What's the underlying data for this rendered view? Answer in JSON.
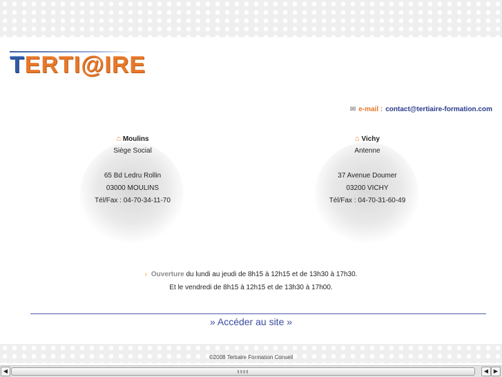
{
  "logo": {
    "first": "T",
    "rest": "ERTI@IRE"
  },
  "email": {
    "icon": "envelope-icon",
    "label": "e-mail :",
    "address": "contact@tertiaire-formation.com"
  },
  "offices": [
    {
      "icon": "home-icon",
      "city": "Moulins",
      "role": "Siège Social",
      "street": "65 Bd Ledru Rollin",
      "postal": "03000 MOULINS",
      "phone": "Tél/Fax : 04-70-34-11-70"
    },
    {
      "icon": "home-icon",
      "city": "Vichy",
      "role": "Antenne",
      "street": "37 Avenue Doumer",
      "postal": "03200 VICHY",
      "phone": "Tél/Fax : 04-70-31-60-49"
    }
  ],
  "hours": {
    "label": "Ouverture",
    "line1": "du lundi au jeudi de 8h15 à 12h15 et de 13h30 à 17h30.",
    "line2": "Et le vendredi de 8h15 à 12h15 et de 13h30 à 17h00."
  },
  "enter_link": "» Accéder au site »",
  "footer": "©2008 Tertiaire Formation Conseil",
  "colors": {
    "orange": "#e8782a",
    "blue": "#2f5ca8",
    "link": "#3a4ba0"
  }
}
